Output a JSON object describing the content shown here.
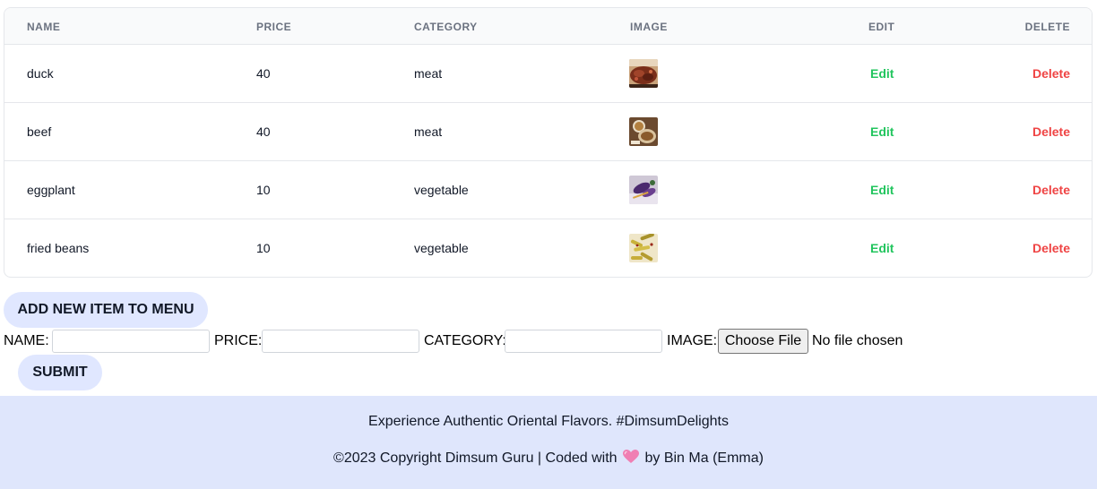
{
  "table": {
    "headers": {
      "name": "NAME",
      "price": "PRICE",
      "category": "CATEGORY",
      "image": "IMAGE",
      "edit": "EDIT",
      "delete": "DELETE"
    },
    "rows": [
      {
        "name": "duck",
        "price": "40",
        "category": "meat",
        "image_icon": "duck-dish-photo",
        "edit": "Edit",
        "delete": "Delete"
      },
      {
        "name": "beef",
        "price": "40",
        "category": "meat",
        "image_icon": "beef-dish-photo",
        "edit": "Edit",
        "delete": "Delete"
      },
      {
        "name": "eggplant",
        "price": "10",
        "category": "vegetable",
        "image_icon": "eggplant-dish-photo",
        "edit": "Edit",
        "delete": "Delete"
      },
      {
        "name": "fried beans",
        "price": "10",
        "category": "vegetable",
        "image_icon": "fried-beans-dish-photo",
        "edit": "Edit",
        "delete": "Delete"
      }
    ]
  },
  "add_form": {
    "toggle_label": "ADD NEW ITEM TO MENU",
    "name_label": "NAME:",
    "name_value": "",
    "price_label": "PRICE:",
    "price_value": "",
    "category_label": "CATEGORY:",
    "category_value": "",
    "image_label": "IMAGE:",
    "file_button_label": "Choose File",
    "file_status": "No file chosen",
    "submit_label": "SUBMIT"
  },
  "footer": {
    "tagline": "Experience Authentic Oriental Flavors. #DimsumDelights",
    "copyright_prefix": "©2023 Copyright Dimsum Guru | Coded with",
    "copyright_suffix": "by Bin Ma (Emma)",
    "heart_icon": "pink-heart-icon"
  },
  "colors": {
    "edit": "#22c55e",
    "delete": "#ef4444",
    "button_bg": "#e0e7ff",
    "footer_bg": "#dfe6fc"
  }
}
